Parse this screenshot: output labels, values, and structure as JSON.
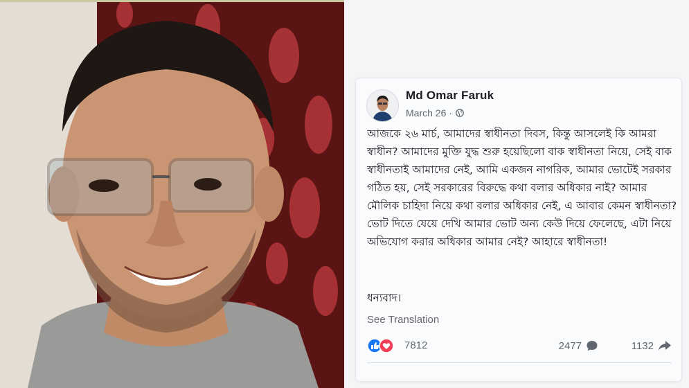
{
  "post": {
    "author": "Md Omar Faruk",
    "date": "March 26 ·",
    "privacy_icon": "globe-icon",
    "text": "আজকে ২৬ মার্চ, আমাদের স্বাধীনতা দিবস, কিন্তু আসলেই কি আমরা স্বাধীন? আমাদের মুক্তি যুদ্ধ শুরু হয়েছিলো বাক স্বাধীনতা নিয়ে, সেই বাক স্বাধীনতাই আমাদের নেই, আমি একজন নাগরিক, আমার ভোটেই সরকার গঠিত হয়, সেই সরকারের বিরুদ্ধে কথা বলার অধিকার নাই? আমার মৌলিক চাহিদা নিয়ে কথা বলার অধিকার নেই, এ আবার কেমন স্বাধীনতা? ভোট দিতে যেয়ে দেখি আমার ভোট অন্য কেউ দিয়ে ফেলেছে, এটা নিয়ে অভিযোগ করার অধিকার আমার নেই? আহারে স্বাধীনতা!",
    "signoff": "ধন্যবাদ।",
    "see_translation": "See Translation"
  },
  "stats": {
    "reaction_icons": [
      "like-icon",
      "love-icon"
    ],
    "reactions": "7812",
    "comments": "2477",
    "shares": "1132"
  },
  "colors": {
    "like": "#1877f2",
    "love": "#f33e58",
    "text": "#1c1e21",
    "muted": "#606770"
  }
}
